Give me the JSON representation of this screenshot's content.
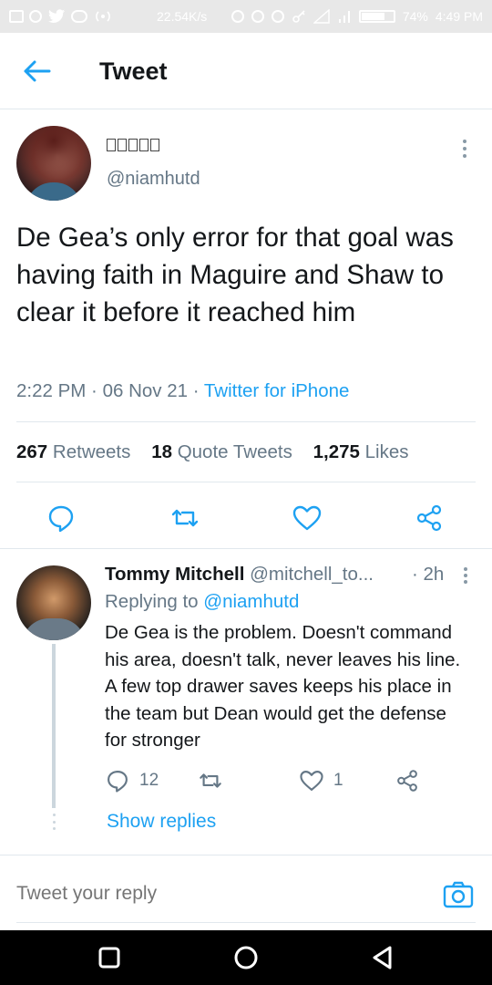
{
  "status_bar": {
    "speed": "22.54K/s",
    "battery": "74%",
    "battery_level": 0.74,
    "time": "4:49 PM"
  },
  "header": {
    "title": "Tweet"
  },
  "tweet": {
    "handle": "@niamhutd",
    "text": "De Gea’s only error for that goal was having faith in Maguire and Shaw to clear it before it reached him",
    "time": "2:22 PM",
    "date": "06 Nov 21",
    "source": "Twitter for iPhone",
    "retweets_count": "267",
    "retweets_label": "Retweets",
    "quotes_count": "18",
    "quotes_label": "Quote Tweets",
    "likes_count": "1,275",
    "likes_label": "Likes"
  },
  "reply": {
    "name": "Tommy Mitchell",
    "handle": "@mitchell_to...",
    "time": "2h",
    "replying_label": "Replying to",
    "replying_to": "@niamhutd",
    "text": "De Gea is the problem. Doesn't command his area, doesn't talk, never leaves his line. A few top drawer saves keeps his place in the team but Dean would get the defense for stronger",
    "reply_count": "12",
    "like_count": "1",
    "show_replies": "Show replies"
  },
  "compose": {
    "placeholder": "Tweet your reply"
  },
  "colors": {
    "accent": "#1da1f2",
    "secondary_text": "#657786",
    "divider": "#e1e8ed"
  },
  "icons": [
    "back-arrow",
    "more-vertical",
    "reply",
    "retweet",
    "like",
    "share",
    "camera",
    "nav-recents",
    "nav-home",
    "nav-back"
  ]
}
